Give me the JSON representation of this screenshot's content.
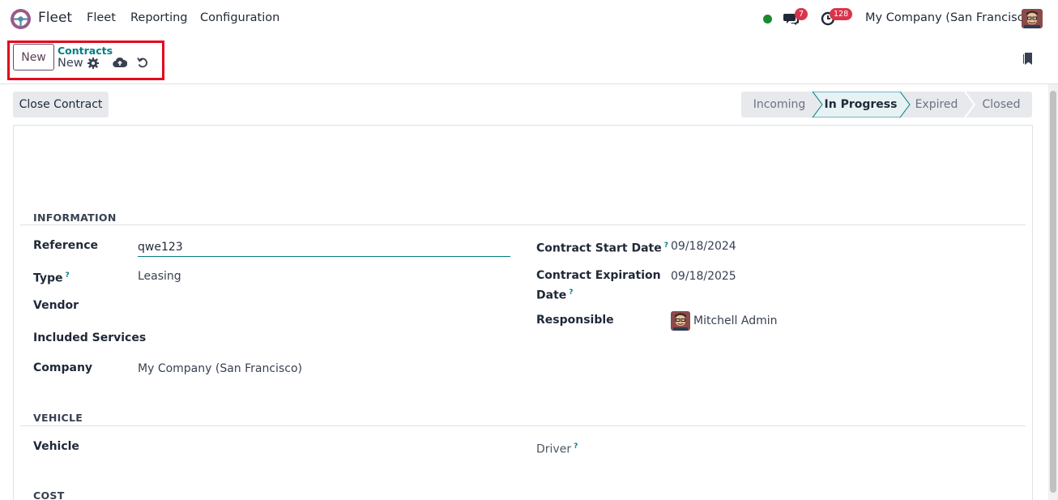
{
  "navbar": {
    "app_name": "Fleet",
    "menu": [
      "Fleet",
      "Reporting",
      "Configuration"
    ],
    "messages_count": "7",
    "activities_count": "128",
    "company": "My Company (San Francisco)"
  },
  "control_panel": {
    "new_button": "New",
    "breadcrumb_parent": "Contracts",
    "breadcrumb_current": "New",
    "icons": [
      "gear-icon",
      "cloud-upload-icon",
      "undo-icon",
      "bookmark-icon"
    ]
  },
  "actions": {
    "close_contract": "Close Contract"
  },
  "statusbar": {
    "stages": [
      "Incoming",
      "In Progress",
      "Expired",
      "Closed"
    ],
    "active_stage": "In Progress"
  },
  "form": {
    "information_title": "INFORMATION",
    "reference_label": "Reference",
    "reference_value": "qwe123",
    "type_label": "Type",
    "type_value": "Leasing",
    "vendor_label": "Vendor",
    "included_services_label": "Included Services",
    "company_label": "Company",
    "company_value": "My Company (San Francisco)",
    "start_date_label": "Contract Start Date",
    "start_date_value": "09/18/2024",
    "expiration_label_line1": "Contract Expiration",
    "expiration_label_line2": "Date",
    "expiration_value": "09/18/2025",
    "responsible_label": "Responsible",
    "responsible_value": "Mitchell Admin",
    "vehicle_title": "VEHICLE",
    "vehicle_label": "Vehicle",
    "driver_label": "Driver",
    "cost_title": "COST",
    "help_mark": "?"
  },
  "colors": {
    "brand_teal": "#017e84",
    "highlight_red": "#e3051b",
    "badge_red": "#d9344b",
    "online_green": "#1a8a2e",
    "new_button_purple": "#6b4a63"
  }
}
